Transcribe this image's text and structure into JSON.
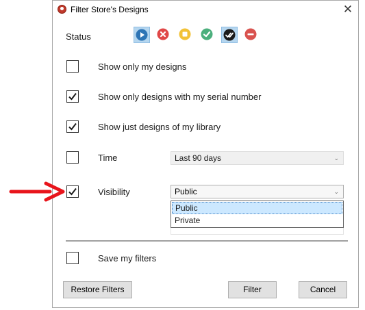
{
  "window": {
    "title": "Filter Store's Designs",
    "close_glyph": "✕"
  },
  "status": {
    "label": "Status",
    "icons": [
      {
        "name": "play-icon",
        "color": "#2e75b6",
        "selected": true
      },
      {
        "name": "cancel-icon",
        "color": "#e04848",
        "selected": false
      },
      {
        "name": "pause-icon",
        "color": "#f2c237",
        "selected": false
      },
      {
        "name": "check-icon",
        "color": "#4caf7d",
        "selected": false
      },
      {
        "name": "double-check-icon",
        "color": "#1a1a1a",
        "selected": true
      },
      {
        "name": "blocked-icon",
        "color": "#d9534f",
        "selected": false
      }
    ]
  },
  "options": {
    "only_mine": {
      "label": "Show only my designs",
      "checked": false
    },
    "serial": {
      "label": "Show only designs with my serial number",
      "checked": true
    },
    "library": {
      "label": "Show just designs of my library",
      "checked": true
    },
    "time": {
      "label": "Time",
      "checked": false,
      "value": "Last 90 days"
    },
    "visibility": {
      "label": "Visibility",
      "checked": true,
      "value": "Public",
      "dropdown_options": [
        "Public",
        "Private"
      ],
      "highlighted": "Public"
    },
    "save": {
      "label": "Save my filters",
      "checked": false
    }
  },
  "buttons": {
    "restore": "Restore Filters",
    "filter": "Filter",
    "cancel": "Cancel"
  },
  "annotation": {
    "arrow_color": "#e8141b"
  }
}
